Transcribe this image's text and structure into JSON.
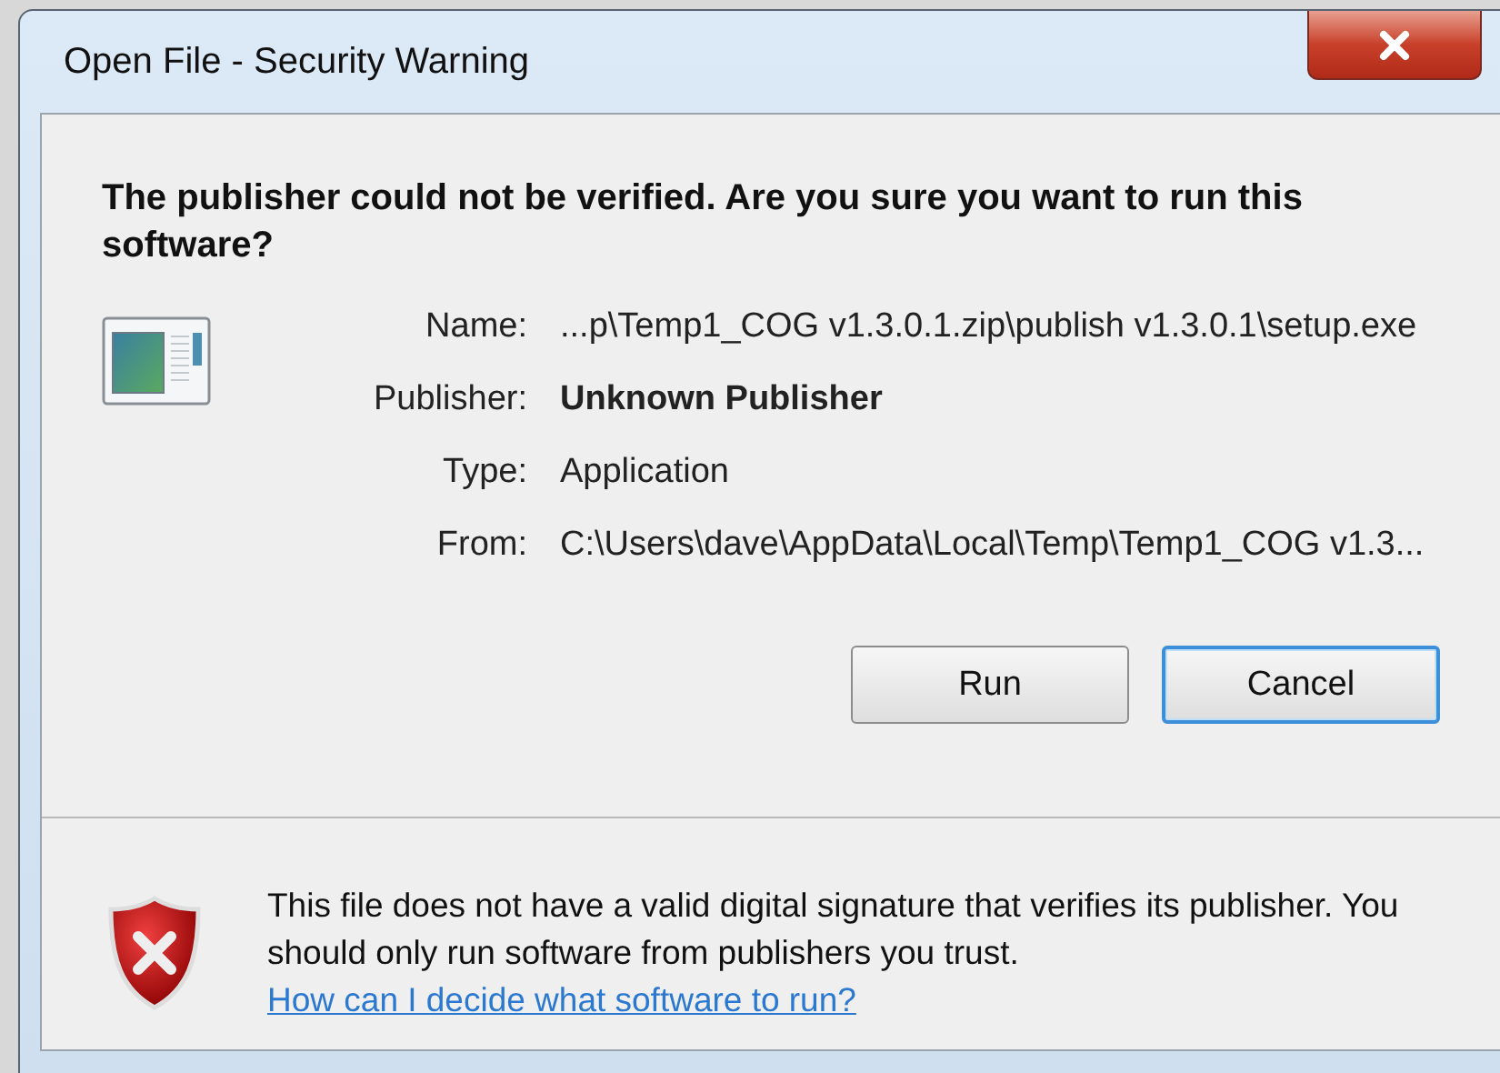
{
  "window": {
    "title": "Open File - Security Warning"
  },
  "heading": "The publisher could not be verified.  Are you sure you want to run this software?",
  "fields": [
    {
      "label": "Name:",
      "value": "...p\\Temp1_COG v1.3.0.1.zip\\publish v1.3.0.1\\setup.exe",
      "bold": false
    },
    {
      "label": "Publisher:",
      "value": "Unknown Publisher",
      "bold": true
    },
    {
      "label": "Type:",
      "value": "Application",
      "bold": false
    },
    {
      "label": "From:",
      "value": "C:\\Users\\dave\\AppData\\Local\\Temp\\Temp1_COG v1.3...",
      "bold": false
    }
  ],
  "buttons": [
    {
      "label": "Run",
      "focused": false
    },
    {
      "label": "Cancel",
      "focused": true
    }
  ],
  "warning": {
    "text": "This file does not have a valid digital signature that verifies its publisher.  You should only run software from publishers you trust.",
    "link": "How can I decide what software to run?"
  }
}
